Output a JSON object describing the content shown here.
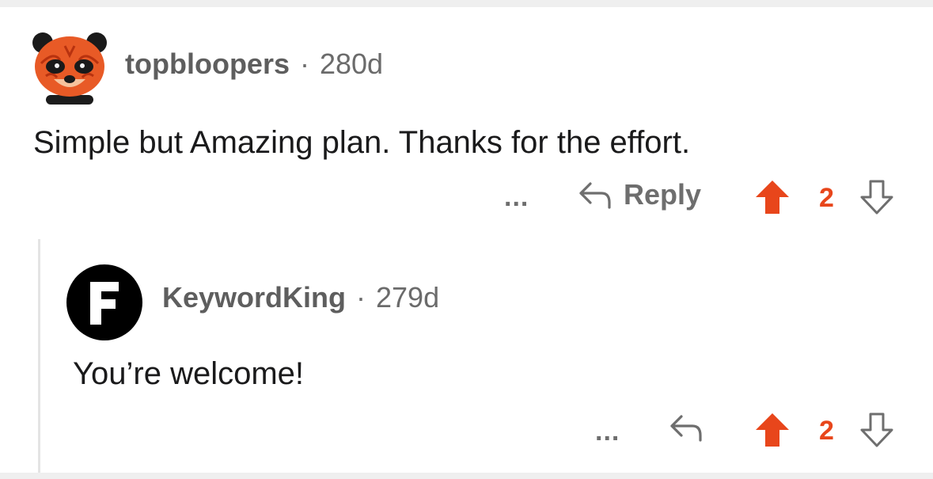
{
  "comments": [
    {
      "username": "topbloopers",
      "separator": "·",
      "age": "280d",
      "body": "Simple but Amazing plan. Thanks for the effort.",
      "actions": {
        "more": "...",
        "reply_label": "Reply",
        "score": "2"
      },
      "avatar": {
        "type": "panda",
        "icon": "panda-avatar-icon"
      }
    },
    {
      "username": "KeywordKing",
      "separator": "·",
      "age": "279d",
      "body": "You’re welcome!",
      "actions": {
        "more": "...",
        "score": "2"
      },
      "avatar": {
        "type": "letter",
        "letter": "F",
        "icon": "letter-f-avatar-icon"
      }
    }
  ],
  "colors": {
    "upvote_active": "#e8461b",
    "meta_text": "#6b6b6b",
    "body_text": "#1a1a1b",
    "thread_line": "#e4e4e4"
  }
}
